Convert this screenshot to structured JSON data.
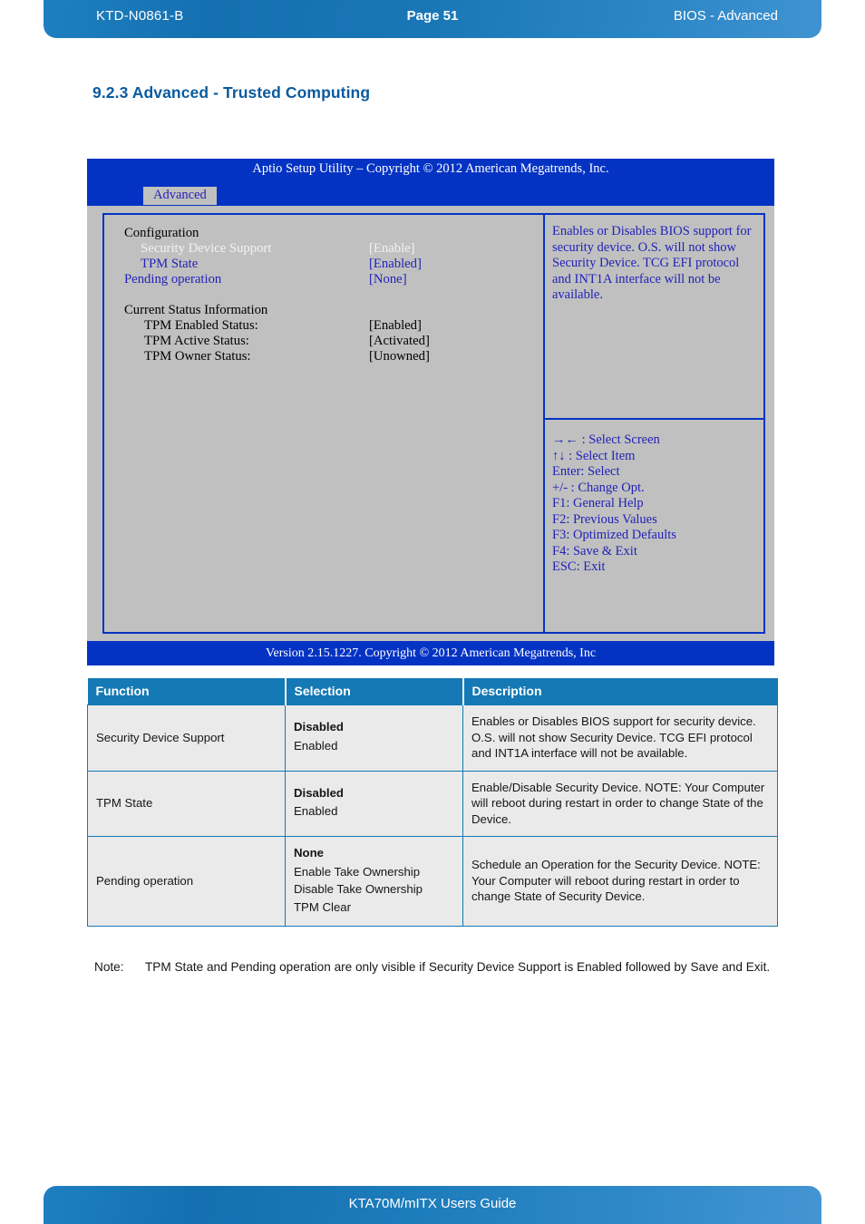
{
  "page_header": {
    "doc_id": "KTD-N0861-B",
    "page_label": "Page 51",
    "section_label": "BIOS  - Advanced"
  },
  "section": {
    "heading": "9.2.3  Advanced  -  Trusted Computing"
  },
  "bios": {
    "title": "Aptio Setup Utility  –  Copyright © 2012 American Megatrends, Inc.",
    "tab": "Advanced",
    "config_heading": "Configuration",
    "config_items": [
      {
        "label": "Security Device Support",
        "value": "[Enable]",
        "style": "selected"
      },
      {
        "label": "TPM State",
        "value": "[Enabled]",
        "style": "link"
      },
      {
        "label": "Pending operation",
        "value": "[None]",
        "style": "link"
      }
    ],
    "status_heading": "Current Status Information",
    "status_items": [
      {
        "label": "TPM Enabled Status:",
        "value": "[Enabled]"
      },
      {
        "label": "TPM Active Status:",
        "value": "[Activated]"
      },
      {
        "label": "TPM Owner Status:",
        "value": "[Unowned]"
      }
    ],
    "help_text": "Enables or Disables BIOS support for security device. O.S. will not show Security Device. TCG EFI protocol and INT1A interface will not be available.",
    "key_legend": [
      "→← : Select Screen",
      "↑↓ : Select Item",
      "Enter: Select",
      "+/- : Change Opt.",
      "F1: General Help",
      "F2: Previous Values",
      "F3: Optimized Defaults",
      "F4: Save & Exit",
      "ESC: Exit"
    ],
    "footer": "Version 2.15.1227. Copyright © 2012 American Megatrends, Inc"
  },
  "table": {
    "headers": [
      "Function",
      "Selection",
      "Description"
    ],
    "rows": [
      {
        "function": "Security Device Support",
        "selection_default": "Disabled",
        "selection_options": [
          "Enabled"
        ],
        "description": "Enables or Disables BIOS support for security device. O.S. will not show Security Device. TCG EFI protocol and INT1A interface will not be available."
      },
      {
        "function": "TPM State",
        "selection_default": "Disabled",
        "selection_options": [
          "Enabled"
        ],
        "description": "Enable/Disable Security Device. NOTE: Your Computer will reboot during restart in order to change State of the Device."
      },
      {
        "function": "Pending operation",
        "selection_default": "None",
        "selection_options": [
          "Enable Take Ownership",
          "Disable Take Ownership",
          "TPM Clear"
        ],
        "description": "Schedule an Operation for the Security Device. NOTE: Your Computer will reboot during restart in order to change State of Security Device."
      }
    ]
  },
  "note": {
    "label": "Note:",
    "text": "TPM State and Pending operation are only visible if Security Device Support is Enabled followed by Save and Exit."
  },
  "page_footer": {
    "title": "KTA70M/mITX Users Guide"
  },
  "colors": {
    "header_blue": "#1a77b6",
    "heading_blue": "#0b5a9e",
    "bios_blue": "#0433c4",
    "bios_gray": "#c0c0c0",
    "bios_text_blue": "#2222b8",
    "table_header_blue": "#1479b5",
    "table_row_gray": "#eaeaea"
  }
}
